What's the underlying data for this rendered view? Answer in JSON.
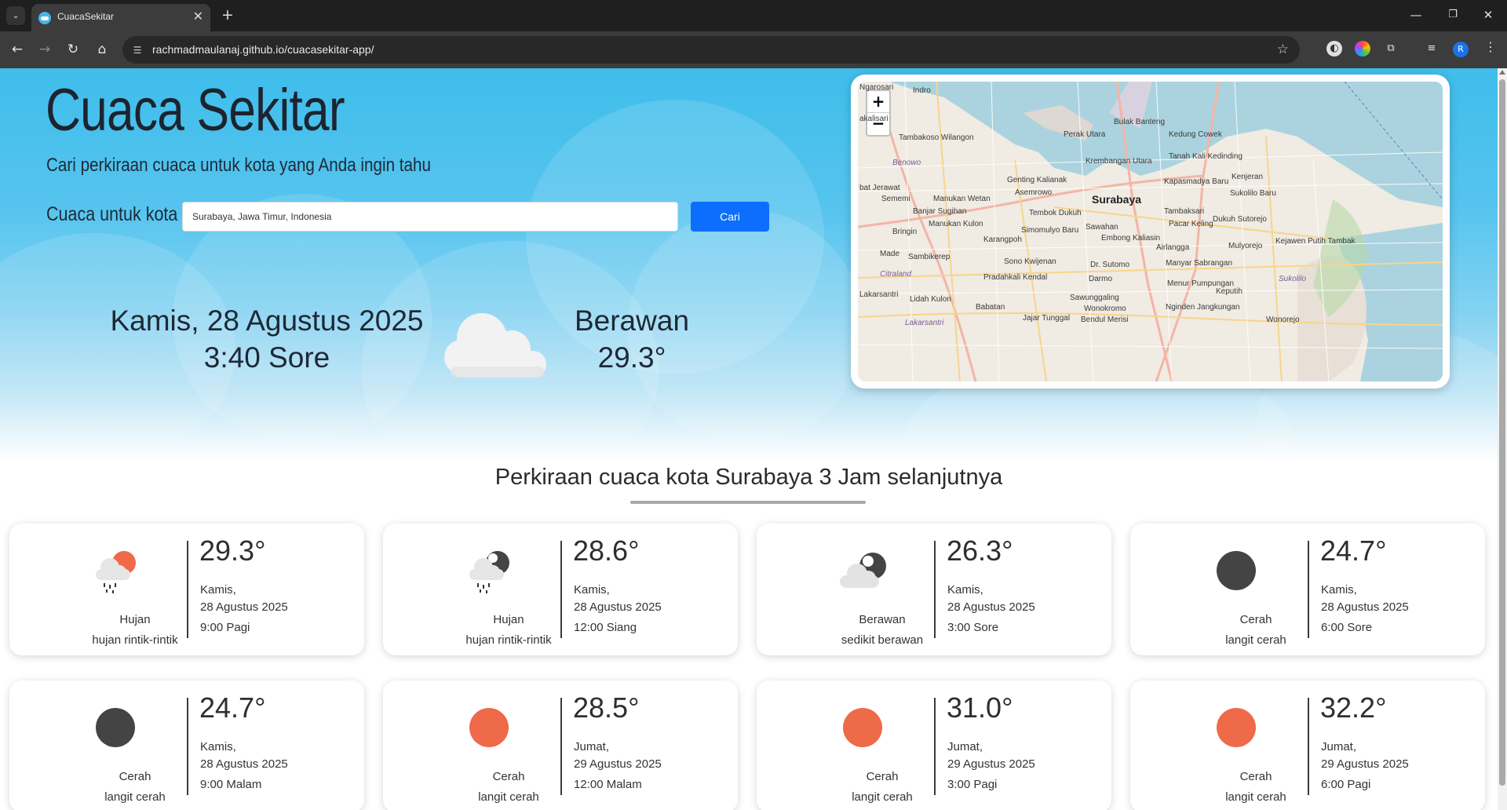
{
  "browser": {
    "tab_title": "CuacaSekitar",
    "url": "rachmadmaulanaj.github.io/cuacasekitar-app/",
    "profile_initial": "R"
  },
  "hero": {
    "title": "Cuaca Sekitar",
    "subtitle": "Cari perkiraan cuaca untuk kota yang Anda ingin tahu",
    "search_label": "Cuaca untuk kota",
    "search_value": "Surabaya, Jawa Timur, Indonesia",
    "search_button": "Cari"
  },
  "current": {
    "date": "Kamis, 28 Agustus 2025",
    "time": "3:40 Sore",
    "condition": "Berawan",
    "temperature": "29.3°",
    "icon": "cloud-icon"
  },
  "map": {
    "zoom_in": "+",
    "zoom_out": "−",
    "labels": [
      {
        "text": "Ngarosari",
        "kind": "normal"
      },
      {
        "text": "Indro",
        "kind": "normal"
      },
      {
        "text": "akalisari",
        "kind": "normal"
      },
      {
        "text": "Tambakoso Wilangon",
        "kind": "normal"
      },
      {
        "text": "Benowo",
        "kind": "water"
      },
      {
        "text": "Perak Utara",
        "kind": "normal"
      },
      {
        "text": "Bulak Banteng",
        "kind": "normal"
      },
      {
        "text": "Kedung Cowek",
        "kind": "normal"
      },
      {
        "text": "Tanah Kali Kedinding",
        "kind": "normal"
      },
      {
        "text": "Krembangan Utara",
        "kind": "normal"
      },
      {
        "text": "Genting Kalianak",
        "kind": "normal"
      },
      {
        "text": "Asemrowo",
        "kind": "normal"
      },
      {
        "text": "Kapasmadya Baru",
        "kind": "normal"
      },
      {
        "text": "Kenjeran",
        "kind": "normal"
      },
      {
        "text": "Sukolilo Baru",
        "kind": "normal"
      },
      {
        "text": "bat Jerawat",
        "kind": "normal"
      },
      {
        "text": "Sememi",
        "kind": "normal"
      },
      {
        "text": "Manukan Wetan",
        "kind": "normal"
      },
      {
        "text": "Surabaya",
        "kind": "big"
      },
      {
        "text": "Banjar Sugihan",
        "kind": "normal"
      },
      {
        "text": "Tembok Dukuh",
        "kind": "normal"
      },
      {
        "text": "Tambaksari",
        "kind": "normal"
      },
      {
        "text": "Pacar Keling",
        "kind": "normal"
      },
      {
        "text": "Dukuh Sutorejo",
        "kind": "normal"
      },
      {
        "text": "Manukan Kulon",
        "kind": "normal"
      },
      {
        "text": "Sawahan",
        "kind": "normal"
      },
      {
        "text": "Bringin",
        "kind": "normal"
      },
      {
        "text": "Simomulyo Baru",
        "kind": "normal"
      },
      {
        "text": "Karangpoh",
        "kind": "normal"
      },
      {
        "text": "Embong Kaliasin",
        "kind": "normal"
      },
      {
        "text": "Airlangga",
        "kind": "normal"
      },
      {
        "text": "Mulyorejo",
        "kind": "normal"
      },
      {
        "text": "Kejawen Putih Tambak",
        "kind": "normal"
      },
      {
        "text": "Made",
        "kind": "normal"
      },
      {
        "text": "Sambikerep",
        "kind": "normal"
      },
      {
        "text": "Sono Kwijenan",
        "kind": "normal"
      },
      {
        "text": "Dr. Sutomo",
        "kind": "normal"
      },
      {
        "text": "Manyar Sabrangan",
        "kind": "normal"
      },
      {
        "text": "Citraland",
        "kind": "water"
      },
      {
        "text": "Pradahkali Kendal",
        "kind": "normal"
      },
      {
        "text": "Darmo",
        "kind": "normal"
      },
      {
        "text": "Menur Pumpungan",
        "kind": "normal"
      },
      {
        "text": "Keputih",
        "kind": "normal"
      },
      {
        "text": "Sukolilo",
        "kind": "water"
      },
      {
        "text": "Lakarsantri",
        "kind": "normal"
      },
      {
        "text": "Lidah Kulon",
        "kind": "normal"
      },
      {
        "text": "Sawunggaling",
        "kind": "normal"
      },
      {
        "text": "Babatan",
        "kind": "normal"
      },
      {
        "text": "Wonokromo",
        "kind": "normal"
      },
      {
        "text": "Nginden Jangkungan",
        "kind": "normal"
      },
      {
        "text": "Jajar Tunggal",
        "kind": "normal"
      },
      {
        "text": "Bendul Merisi",
        "kind": "normal"
      },
      {
        "text": "Wonorejo",
        "kind": "normal"
      },
      {
        "text": "Lakarsantri",
        "kind": "water"
      }
    ]
  },
  "forecast": {
    "title": "Perkiraan cuaca kota Surabaya 3 Jam selanjutnya",
    "cards": [
      {
        "temp": "29.3°",
        "day": "Kamis,",
        "date": "28 Agustus 2025",
        "time": "9:00 Pagi",
        "condition": "Hujan",
        "detail": "hujan rintik-rintik",
        "icon": "rain-sun-icon"
      },
      {
        "temp": "28.6°",
        "day": "Kamis,",
        "date": "28 Agustus 2025",
        "time": "12:00 Siang",
        "condition": "Hujan",
        "detail": "hujan rintik-rintik",
        "icon": "rain-moon-icon"
      },
      {
        "temp": "26.3°",
        "day": "Kamis,",
        "date": "28 Agustus 2025",
        "time": "3:00 Sore",
        "condition": "Berawan",
        "detail": "sedikit berawan",
        "icon": "cloud-moon-icon"
      },
      {
        "temp": "24.7°",
        "day": "Kamis,",
        "date": "28 Agustus 2025",
        "time": "6:00 Sore",
        "condition": "Cerah",
        "detail": "langit cerah",
        "icon": "moon-icon"
      },
      {
        "temp": "24.7°",
        "day": "Kamis,",
        "date": "28 Agustus 2025",
        "time": "9:00 Malam",
        "condition": "Cerah",
        "detail": "langit cerah",
        "icon": "moon-icon"
      },
      {
        "temp": "28.5°",
        "day": "Jumat,",
        "date": "29 Agustus 2025",
        "time": "12:00 Malam",
        "condition": "Cerah",
        "detail": "langit cerah",
        "icon": "sun-icon"
      },
      {
        "temp": "31.0°",
        "day": "Jumat,",
        "date": "29 Agustus 2025",
        "time": "3:00 Pagi",
        "condition": "Cerah",
        "detail": "langit cerah",
        "icon": "sun-icon"
      },
      {
        "temp": "32.2°",
        "day": "Jumat,",
        "date": "29 Agustus 2025",
        "time": "6:00 Pagi",
        "condition": "Cerah",
        "detail": "langit cerah",
        "icon": "sun-icon"
      }
    ]
  },
  "colors": {
    "sky": "#3fbdeb",
    "button": "#0d6efd",
    "sun": "#ee6a48",
    "moon": "#444444"
  }
}
